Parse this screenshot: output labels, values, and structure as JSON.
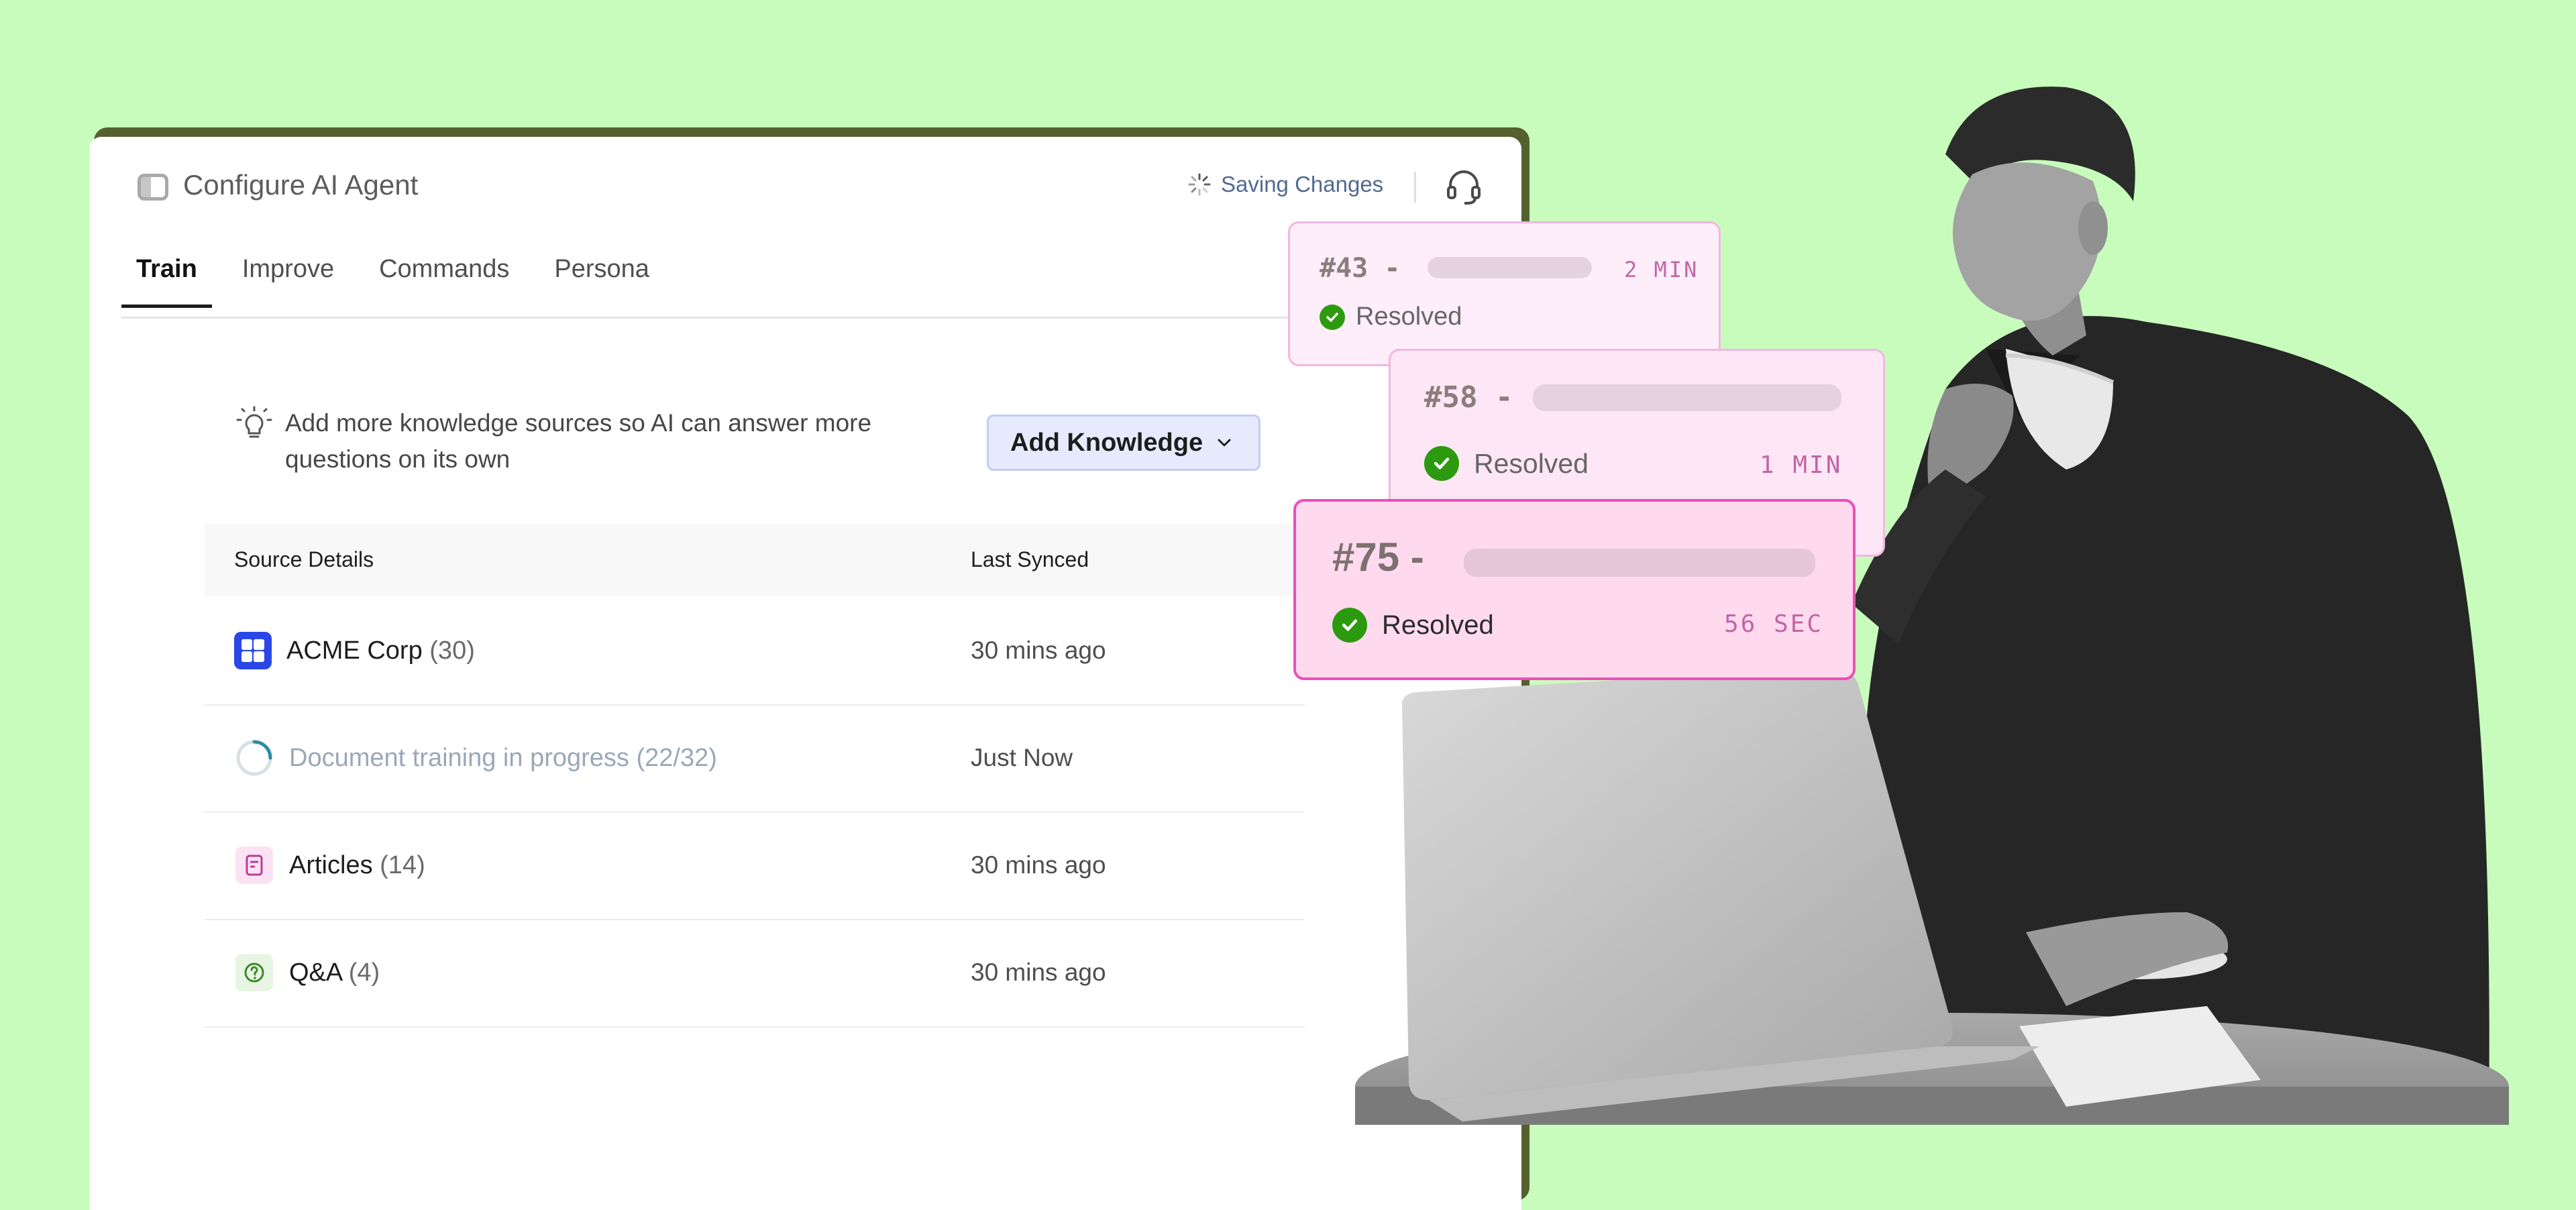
{
  "header": {
    "title": "Configure AI Agent",
    "saving_label": "Saving Changes"
  },
  "tabs": [
    {
      "label": "Train",
      "active": true
    },
    {
      "label": "Improve"
    },
    {
      "label": "Commands"
    },
    {
      "label": "Persona"
    }
  ],
  "tip": {
    "text": "Add more knowledge sources so AI can answer more questions on its own"
  },
  "add_button": {
    "label": "Add Knowledge"
  },
  "table": {
    "columns": [
      "Source Details",
      "Last Synced"
    ],
    "rows": [
      {
        "name": "ACME Corp",
        "count": "(30)",
        "synced": "30 mins ago",
        "icon": "grid-app-icon"
      },
      {
        "name": "Document training in progress",
        "count": "(22/32)",
        "synced": "Just Now",
        "icon": "progress-spinner-icon",
        "progress": 0.6875
      },
      {
        "name": "Articles",
        "count": "(14)",
        "synced": "30 mins ago",
        "icon": "document-icon"
      },
      {
        "name": "Q&A",
        "count": "(4)",
        "synced": "30 mins ago",
        "icon": "question-icon"
      }
    ]
  },
  "tickets": [
    {
      "number": "#43 -",
      "status": "Resolved",
      "time": "2 MIN"
    },
    {
      "number": "#58 -",
      "status": "Resolved",
      "time": "1 MIN"
    },
    {
      "number": "#75 -",
      "status": "Resolved",
      "time": "56 SEC"
    }
  ],
  "colors": {
    "background": "#c8fcbc",
    "window_border": "#55602f",
    "accent_blue": "#2a47e6",
    "resolved_green": "#2c9a0e",
    "ticket_pink": "#ea4fb9",
    "time_text": "#c265a6"
  }
}
